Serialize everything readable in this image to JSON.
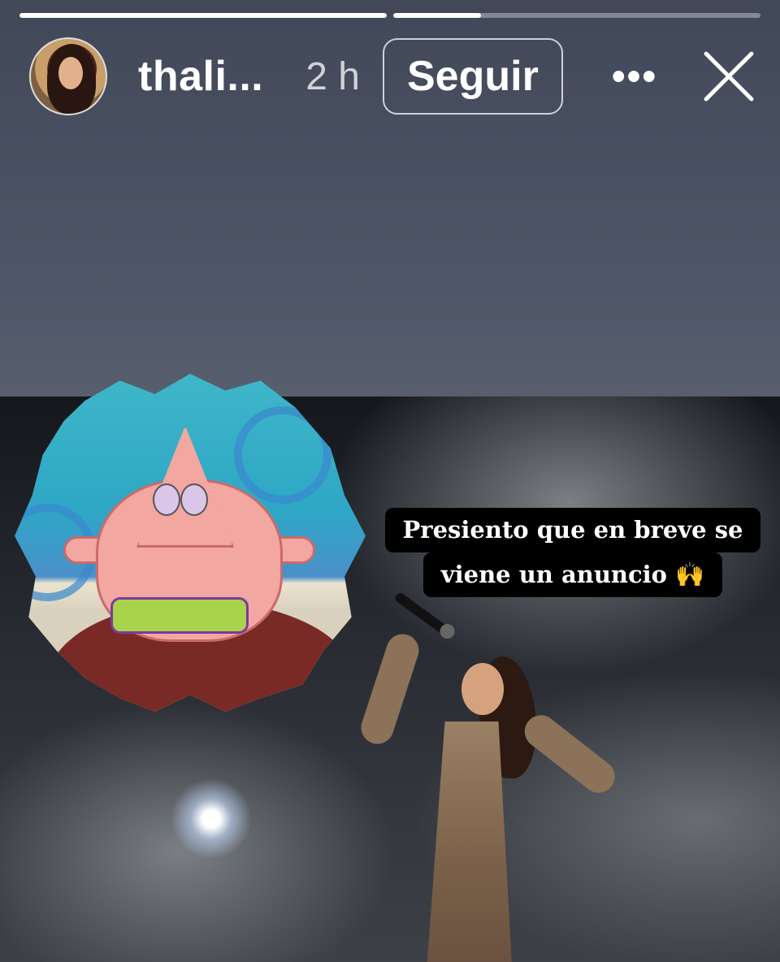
{
  "story": {
    "progress": [
      1.0,
      0.24
    ],
    "user": {
      "username": "thali...",
      "time": "2 h"
    },
    "follow_label": "Seguir",
    "more_label": "•••",
    "caption": {
      "line1": "Presiento que en breve se",
      "line2": "viene un anuncio 🙌"
    }
  }
}
